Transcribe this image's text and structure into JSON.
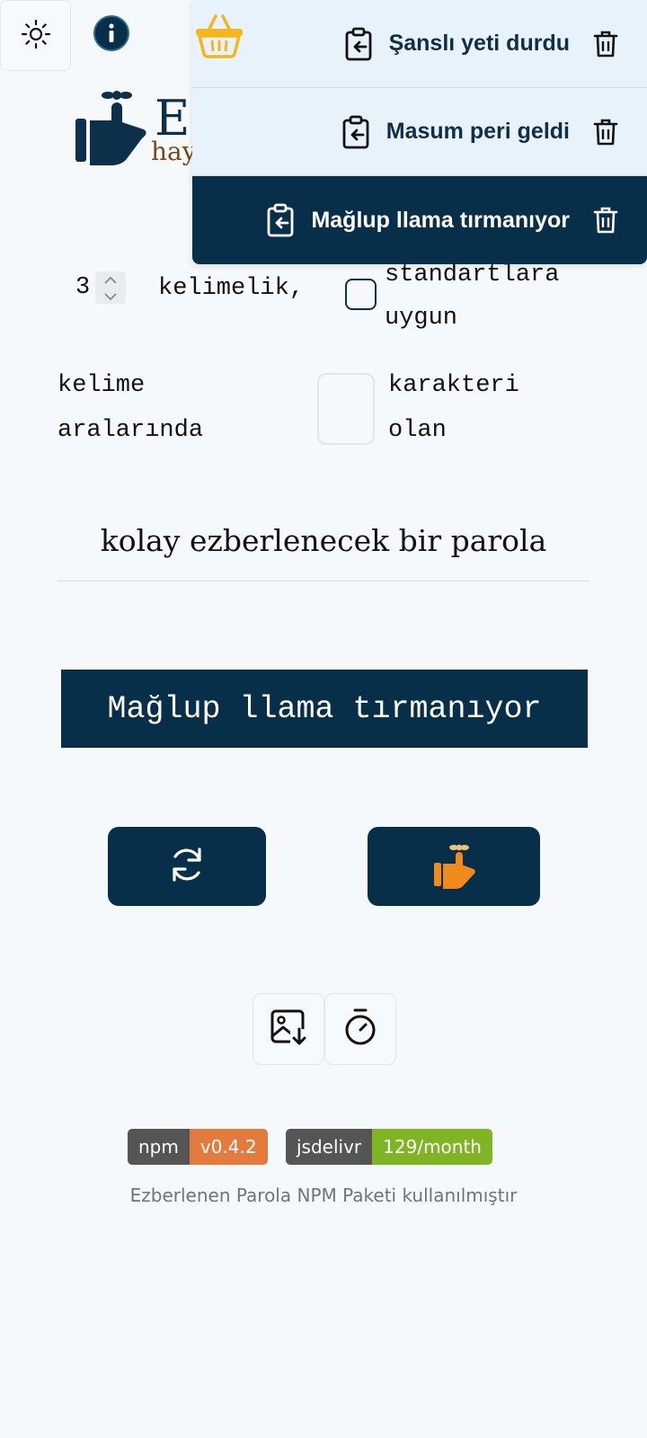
{
  "header": {
    "theme_icon": "sun-icon",
    "info_icon": "info-icon",
    "logo_letter": "E",
    "logo_subtext": "hay"
  },
  "history": {
    "basket_icon": "basket-icon",
    "items": [
      {
        "label": "Şanslı yeti durdu",
        "active": false
      },
      {
        "label": "Masum peri geldi",
        "active": false
      },
      {
        "label": "Mağlup llama tırmanıyor",
        "active": true
      }
    ]
  },
  "options": {
    "word_count": "3",
    "words_label": "kelimelik,",
    "standard_label": "standartlara uygun",
    "between_label": "kelime aralarında",
    "character_label": "karakteri olan"
  },
  "main": {
    "subtitle": "kolay ezberlenecek bir parola",
    "password": "Mağlup llama tırmanıyor"
  },
  "badges": {
    "npm_label": "npm",
    "npm_value": "v0.4.2",
    "jsdelivr_label": "jsdelivr",
    "jsdelivr_value": "129/month"
  },
  "footer": {
    "text": "Ezberlenen Parola NPM Paketi kullanılmıştır"
  },
  "colors": {
    "primary": "#072f49",
    "accent_orange": "#f08a1c",
    "background": "#f5f9fc"
  }
}
